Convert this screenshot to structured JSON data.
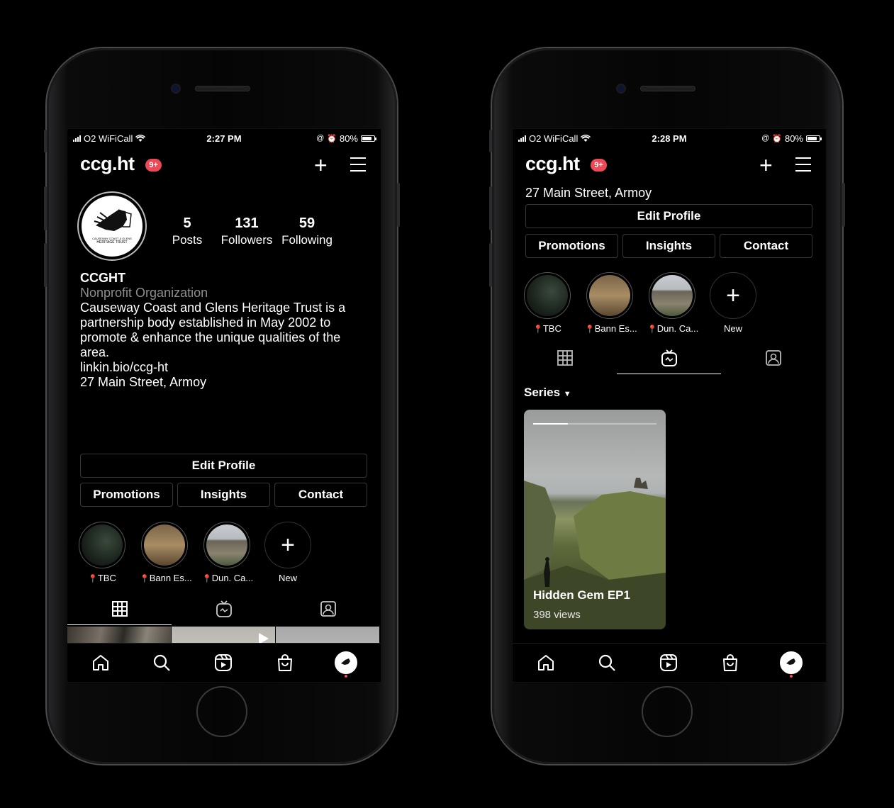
{
  "left": {
    "status": {
      "carrier": "O2 WiFiCall",
      "time": "2:27 PM",
      "battery": "80%"
    },
    "username": "ccg.ht",
    "notif": "9+",
    "stats": [
      {
        "n": "5",
        "l": "Posts"
      },
      {
        "n": "131",
        "l": "Followers"
      },
      {
        "n": "59",
        "l": "Following"
      }
    ],
    "avatar_text": [
      "CAUSEWAY COAST & GLENS",
      "HERITAGE TRUST"
    ],
    "bio": {
      "name": "CCGHT",
      "category": "Nonprofit Organization",
      "text": "Causeway Coast and Glens Heritage Trust is a partnership body established in May 2002 to promote & enhance the unique qualities of the area.",
      "link": "linkin.bio/ccg-ht",
      "address": "27 Main Street, Armoy"
    },
    "buttons": {
      "edit": "Edit Profile",
      "promotions": "Promotions",
      "insights": "Insights",
      "contact": "Contact"
    },
    "stories": [
      "TBC",
      "Bann Es...",
      "Dun. Ca...",
      "New"
    ]
  },
  "right": {
    "status": {
      "carrier": "O2 WiFiCall",
      "time": "2:28 PM",
      "battery": "80%"
    },
    "username": "ccg.ht",
    "notif": "9+",
    "address": "27 Main Street, Armoy",
    "buttons": {
      "edit": "Edit Profile",
      "promotions": "Promotions",
      "insights": "Insights",
      "contact": "Contact"
    },
    "stories": [
      "TBC",
      "Bann Es...",
      "Dun. Ca...",
      "New"
    ],
    "series_label": "Series",
    "card": {
      "title": "Hidden Gem EP1",
      "views": "398 views",
      "progress": 0.28
    }
  },
  "colors": {
    "accent_red": "#ed4956",
    "border": "#363636",
    "muted": "#8e8e8e"
  }
}
